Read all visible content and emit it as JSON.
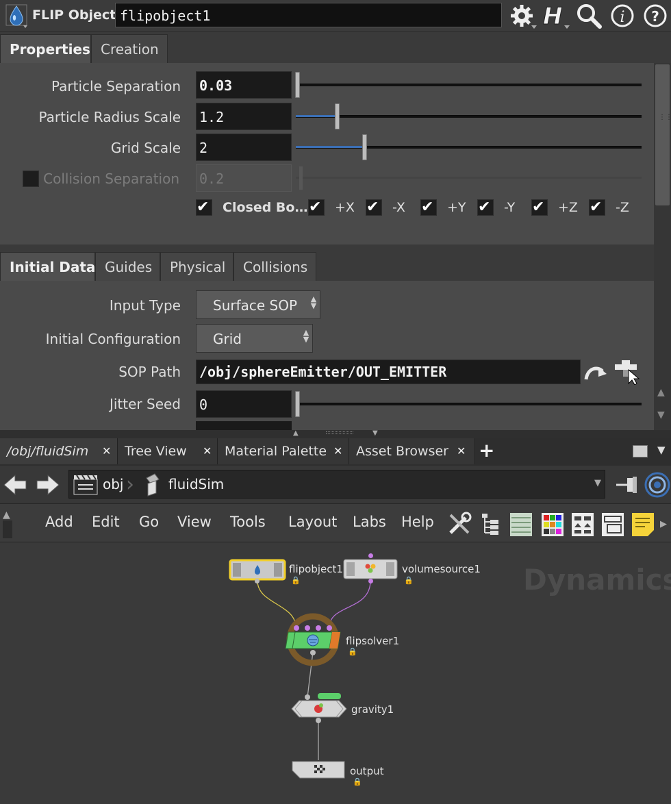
{
  "header": {
    "node_type": "FLIP Object",
    "node_name": "flipobject1",
    "icons": [
      "gear-icon",
      "houdini-help-icon",
      "search-icon",
      "info-icon",
      "help-icon"
    ]
  },
  "tabs_top": [
    "Properties",
    "Creation"
  ],
  "properties": {
    "particle_separation": {
      "label": "Particle Separation",
      "value": "0.03",
      "fraction": 0.0
    },
    "particle_radius_scale": {
      "label": "Particle Radius Scale",
      "value": "1.2",
      "fraction": 0.12
    },
    "grid_scale": {
      "label": "Grid Scale",
      "value": "2",
      "fraction": 0.2
    },
    "collision_separation": {
      "label": "Collision Separation",
      "value": "0.2",
      "enabled": false
    },
    "closed_boundaries": {
      "label": "Closed Bo…",
      "axes": [
        "+X",
        "-X",
        "+Y",
        "-Y",
        "+Z",
        "-Z"
      ]
    }
  },
  "tabs_bottom": [
    "Initial Data",
    "Guides",
    "Physical",
    "Collisions"
  ],
  "initial_data": {
    "input_type": {
      "label": "Input Type",
      "value": "Surface SOP"
    },
    "initial_configuration": {
      "label": "Initial Configuration",
      "value": "Grid"
    },
    "sop_path": {
      "label": "SOP Path",
      "value": "/obj/sphereEmitter/OUT_EMITTER"
    },
    "jitter_seed": {
      "label": "Jitter Seed",
      "value": "0",
      "fraction": 0.0
    }
  },
  "pane_tabs": [
    "/obj/fluidSim",
    "Tree View",
    "Material Palette",
    "Asset Browser"
  ],
  "path": {
    "root": "obj",
    "child": "fluidSim"
  },
  "menu": [
    "Add",
    "Edit",
    "Go",
    "View",
    "Tools",
    "Layout",
    "Labs",
    "Help"
  ],
  "network": {
    "watermark": "Dynamics",
    "nodes": {
      "flipobject": "flipobject1",
      "volumesource": "volumesource1",
      "flipsolver": "flipsolver1",
      "gravity": "gravity1",
      "output": "output"
    }
  },
  "colors": {
    "accent_blue": "#3b6fb5",
    "selected_yellow": "#f2d02a",
    "solver_green": "#5ccf6a",
    "wire_purple": "#c77de6"
  }
}
